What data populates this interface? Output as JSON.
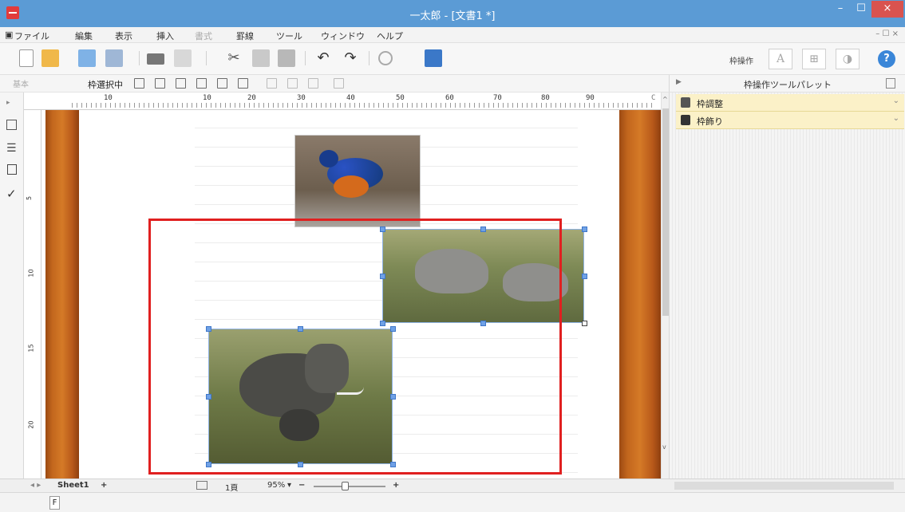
{
  "window": {
    "title": "一太郎 - [文書1 *]",
    "min": "–",
    "max": "☐",
    "close": "×"
  },
  "menu": {
    "items": [
      "ファイル",
      "編集",
      "表示",
      "挿入",
      "書式",
      "罫線",
      "ツール",
      "ウィンドウ",
      "ヘルプ"
    ],
    "mdi": "– ☐ ×"
  },
  "toolbar1": {
    "frame_ops_label": "枠操作",
    "btn_text": "A",
    "btn_table": "⊞",
    "btn_shape": "◑",
    "help": "?"
  },
  "toolbar2": {
    "style_select": "基本",
    "mode_label": "枠選択中"
  },
  "ruler": {
    "numbers": [
      "10",
      "10",
      "20",
      "30",
      "40",
      "50",
      "60",
      "70",
      "80",
      "90"
    ],
    "corner": "C"
  },
  "vruler": {
    "numbers": [
      "5",
      "10",
      "15",
      "20"
    ]
  },
  "palette": {
    "title": "枠操作ツールパレット",
    "sections": [
      {
        "label": "枠調整",
        "icon": "frame-adjust-icon"
      },
      {
        "label": "枠飾り",
        "icon": "frame-decorate-icon"
      }
    ]
  },
  "status": {
    "sheet_tab": "Sheet1",
    "add_sheet": "+",
    "page": "1頁",
    "zoom": "95%",
    "zoom_dropdown": "▾",
    "zoom_out": "−",
    "zoom_in": "+",
    "f_key": "F"
  },
  "colors": {
    "titlebar": "#5b9bd5",
    "highlight_box": "#e02020",
    "palette_section": "#fbf1c8"
  }
}
